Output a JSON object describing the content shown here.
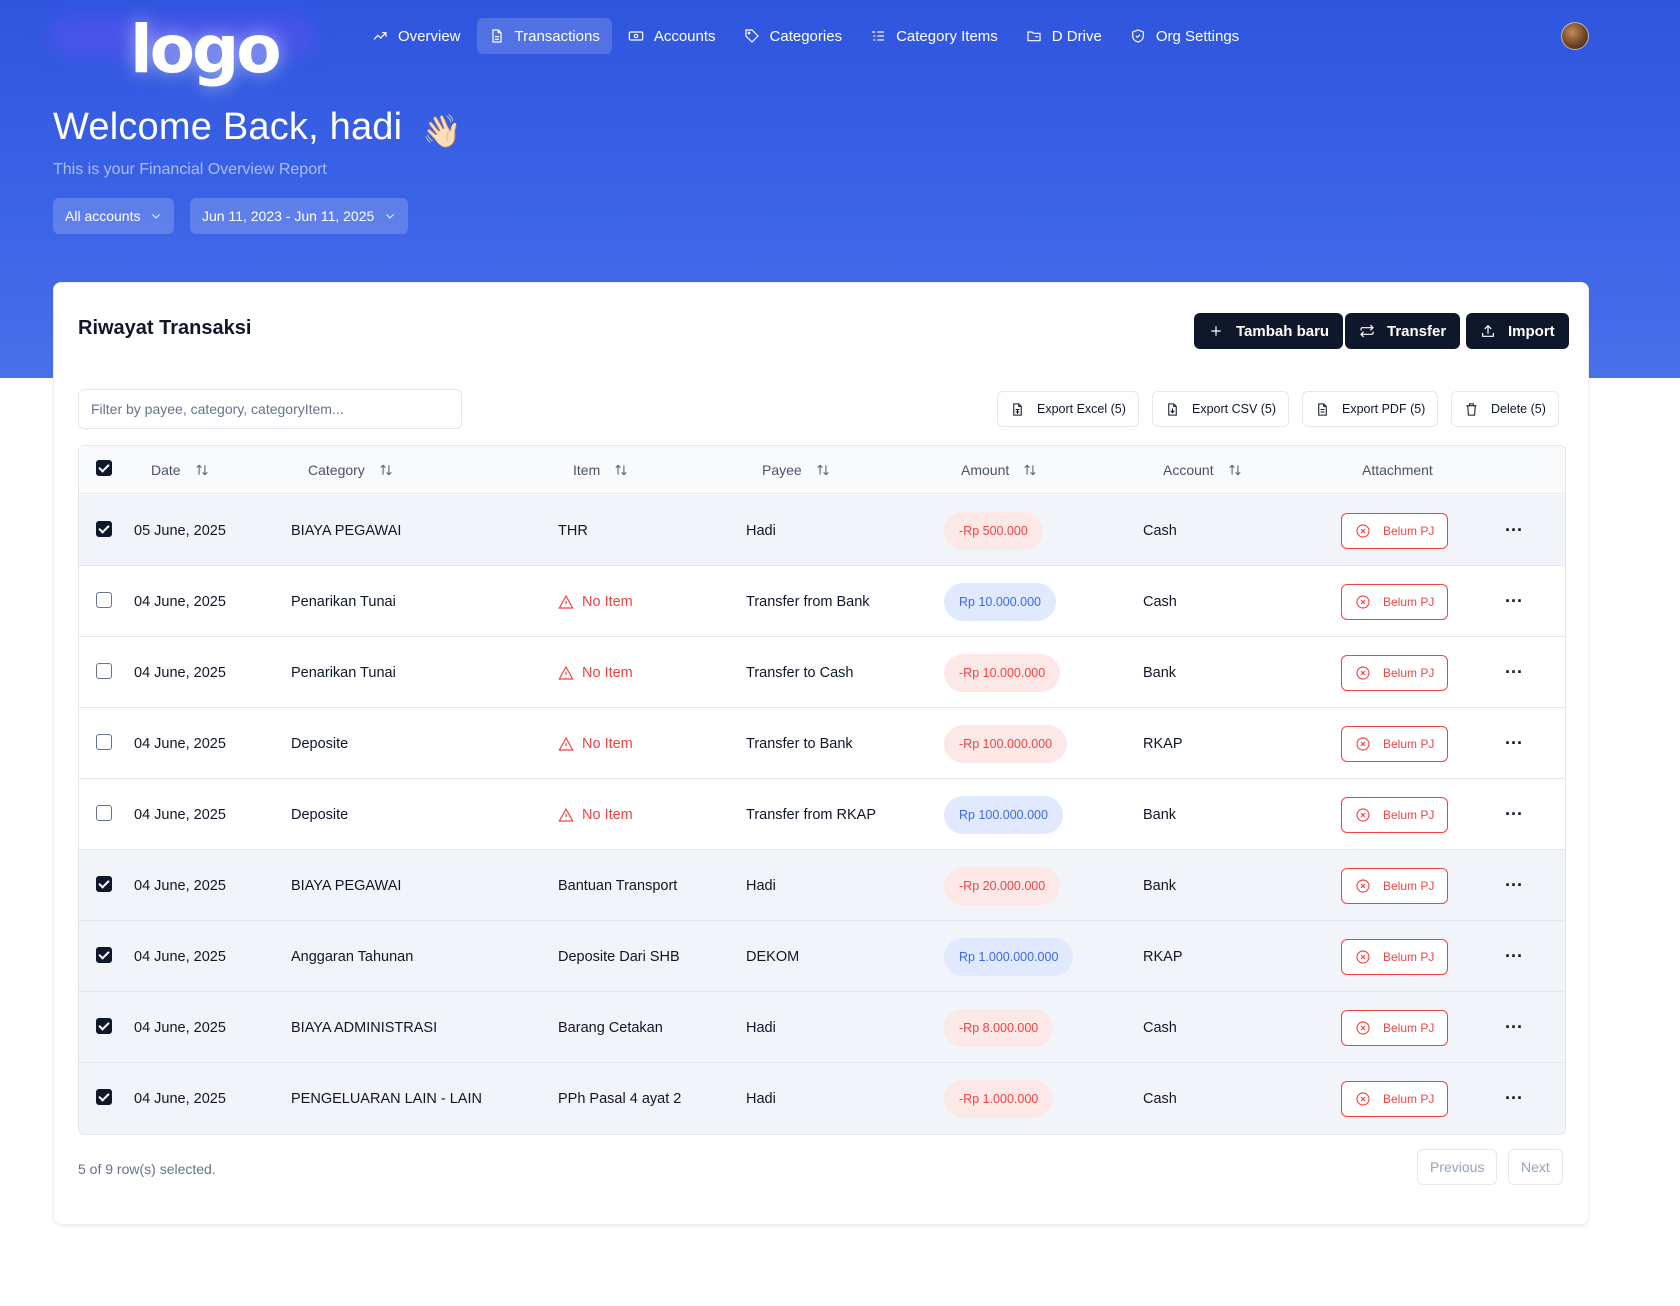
{
  "brand": {
    "logo_text": "logo"
  },
  "nav": {
    "items": [
      {
        "label": "Overview",
        "icon": "trending-up-icon",
        "active": false
      },
      {
        "label": "Transactions",
        "icon": "file-text-icon",
        "active": true
      },
      {
        "label": "Accounts",
        "icon": "banknote-icon",
        "active": false
      },
      {
        "label": "Categories",
        "icon": "tag-icon",
        "active": false
      },
      {
        "label": "Category Items",
        "icon": "list-icon",
        "active": false
      },
      {
        "label": "D Drive",
        "icon": "folder-icon",
        "active": false
      },
      {
        "label": "Org Settings",
        "icon": "shield-icon",
        "active": false
      }
    ]
  },
  "hero": {
    "welcome": "Welcome Back, hadi",
    "wave_emoji": "👋🏻",
    "subtitle": "This is your Financial Overview Report",
    "account_filter": "All accounts",
    "date_range": "Jun 11, 2023 - Jun 11, 2025"
  },
  "card": {
    "title": "Riwayat Transaksi",
    "actions": {
      "add": "Tambah baru",
      "transfer": "Transfer",
      "import": "Import"
    },
    "search_placeholder": "Filter by payee, category, categoryItem...",
    "exports": {
      "excel": "Export Excel (5)",
      "csv": "Export CSV (5)",
      "pdf": "Export PDF (5)",
      "delete": "Delete (5)"
    }
  },
  "table": {
    "columns": {
      "date": "Date",
      "category": "Category",
      "item": "Item",
      "payee": "Payee",
      "amount": "Amount",
      "account": "Account",
      "attachment": "Attachment"
    },
    "header_checked": true,
    "rows": [
      {
        "checked": true,
        "date": "05 June, 2025",
        "category": "BIAYA PEGAWAI",
        "item": "THR",
        "no_item": false,
        "payee": "Hadi",
        "amount": "-Rp 500.000",
        "negative": true,
        "account": "Cash",
        "attachment": "Belum PJ"
      },
      {
        "checked": false,
        "date": "04 June, 2025",
        "category": "Penarikan Tunai",
        "item": "No Item",
        "no_item": true,
        "payee": "Transfer from Bank",
        "amount": "Rp 10.000.000",
        "negative": false,
        "account": "Cash",
        "attachment": "Belum PJ"
      },
      {
        "checked": false,
        "date": "04 June, 2025",
        "category": "Penarikan Tunai",
        "item": "No Item",
        "no_item": true,
        "payee": "Transfer to Cash",
        "amount": "-Rp 10.000.000",
        "negative": true,
        "account": "Bank",
        "attachment": "Belum PJ"
      },
      {
        "checked": false,
        "date": "04 June, 2025",
        "category": "Deposite",
        "item": "No Item",
        "no_item": true,
        "payee": "Transfer to Bank",
        "amount": "-Rp 100.000.000",
        "negative": true,
        "account": "RKAP",
        "attachment": "Belum PJ"
      },
      {
        "checked": false,
        "date": "04 June, 2025",
        "category": "Deposite",
        "item": "No Item",
        "no_item": true,
        "payee": "Transfer from RKAP",
        "amount": "Rp 100.000.000",
        "negative": false,
        "account": "Bank",
        "attachment": "Belum PJ"
      },
      {
        "checked": true,
        "date": "04 June, 2025",
        "category": "BIAYA PEGAWAI",
        "item": "Bantuan Transport",
        "no_item": false,
        "payee": "Hadi",
        "amount": "-Rp 20.000.000",
        "negative": true,
        "account": "Bank",
        "attachment": "Belum PJ"
      },
      {
        "checked": true,
        "date": "04 June, 2025",
        "category": "Anggaran Tahunan",
        "item": "Deposite Dari SHB",
        "no_item": false,
        "payee": "DEKOM",
        "amount": "Rp 1.000.000.000",
        "negative": false,
        "account": "RKAP",
        "attachment": "Belum PJ"
      },
      {
        "checked": true,
        "date": "04 June, 2025",
        "category": "BIAYA ADMINISTRASI",
        "item": "Barang Cetakan",
        "no_item": false,
        "payee": "Hadi",
        "amount": "-Rp 8.000.000",
        "negative": true,
        "account": "Cash",
        "attachment": "Belum PJ"
      },
      {
        "checked": true,
        "date": "04 June, 2025",
        "category": "PENGELUARAN LAIN - LAIN",
        "item": "PPh Pasal 4 ayat 2",
        "no_item": false,
        "payee": "Hadi",
        "amount": "-Rp 1.000.000",
        "negative": true,
        "account": "Cash",
        "attachment": "Belum PJ"
      }
    ]
  },
  "footer": {
    "selection": "5 of 9 row(s) selected.",
    "previous": "Previous",
    "next": "Next"
  },
  "colors": {
    "hero": "#3b63e6",
    "dark": "#0f172a",
    "negative": "#ef4444",
    "positive": "#3b6ae6"
  }
}
